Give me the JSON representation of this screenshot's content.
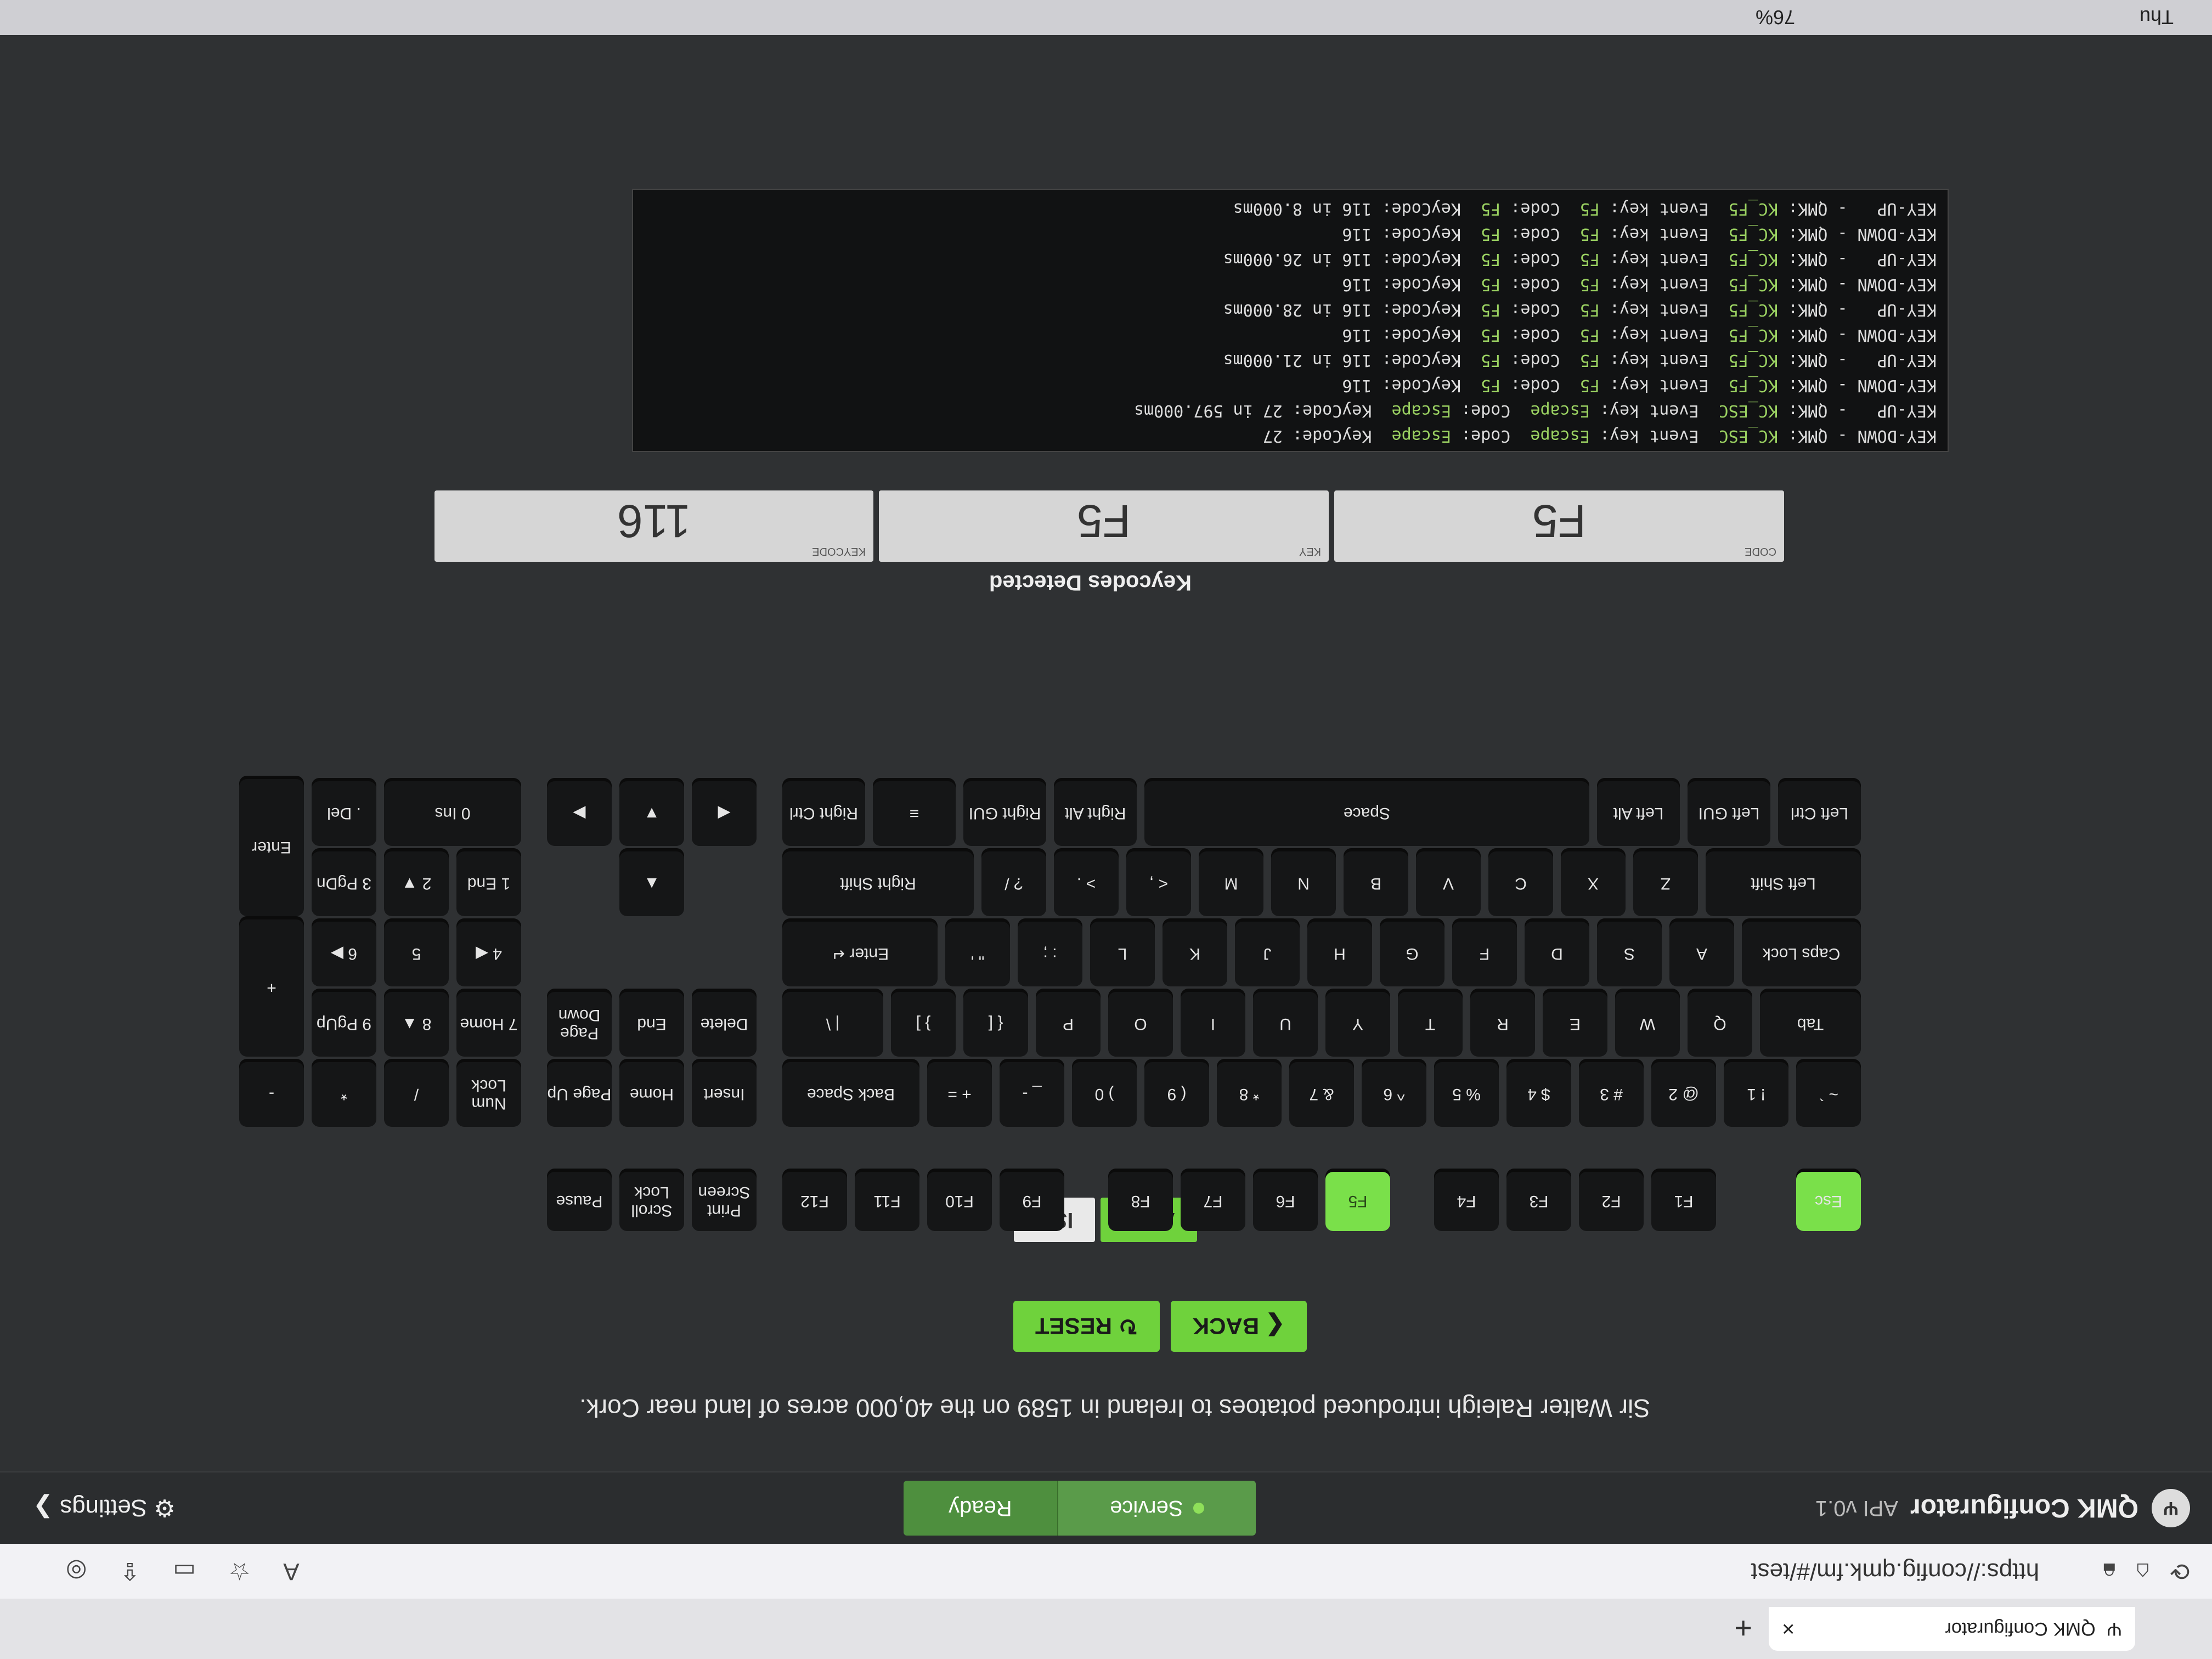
{
  "browser": {
    "tab_title": "QMK Configurator",
    "tab_close": "×",
    "new_tab": "+",
    "url": "https://config.qmk.fm/#/test",
    "os_clock": "Thu",
    "battery": "76%"
  },
  "app": {
    "logo_text": "Ψ",
    "title": "QMK Configurator",
    "api_version": "API v0.1",
    "status_service": "Service",
    "status_ready": "Ready",
    "settings": "Settings"
  },
  "tip": "Sir Walter Raleigh introduced potatoes to Ireland in 1589 on the 40,000 acres of land near Cork.",
  "buttons": {
    "back": "❮ BACK",
    "reset": "↻ RESET"
  },
  "layout_switch": {
    "ansi": "ANSI",
    "iso": "ISO"
  },
  "keys": {
    "esc": "Esc",
    "f1": "F1",
    "f2": "F2",
    "f3": "F3",
    "f4": "F4",
    "f5": "F5",
    "f6": "F6",
    "f7": "F7",
    "f8": "F8",
    "f9": "F9",
    "f10": "F10",
    "f11": "F11",
    "f12": "F12",
    "prtsc": "Print Screen",
    "scrlk": "Scroll Lock",
    "pause": "Pause",
    "grave": "~ `",
    "n1": "! 1",
    "n2": "@ 2",
    "n3": "# 3",
    "n4": "$ 4",
    "n5": "% 5",
    "n6": "^ 6",
    "n7": "& 7",
    "n8": "* 8",
    "n9": "( 9",
    "n0": ") 0",
    "minus": "_ -",
    "equal": "+ =",
    "bksp": "Back Space",
    "ins": "Insert",
    "home": "Home",
    "pgup": "Page Up",
    "numlk": "Num Lock",
    "pslash": "/",
    "pstar": "*",
    "pminus": "-",
    "tab": "Tab",
    "q": "Q",
    "w": "W",
    "e": "E",
    "r": "R",
    "t": "T",
    "y": "Y",
    "u": "U",
    "i": "I",
    "o": "O",
    "p": "P",
    "lbr": "{ [",
    "rbr": "} ]",
    "bsl": "| \\",
    "del": "Delete",
    "end": "End",
    "pgdn": "Page Down",
    "p7": "7 Home",
    "p8": "8 ▲",
    "p9": "9 PgUp",
    "pplus": "+",
    "caps": "Caps Lock",
    "a": "A",
    "s": "S",
    "d": "D",
    "f": "F",
    "g": "G",
    "h": "H",
    "j": "J",
    "k": "K",
    "l": "L",
    "semi": ": ;",
    "quot": "\" '",
    "enter": "Enter ↵",
    "p4": "4 ◀",
    "p5": "5",
    "p6": "6 ▶",
    "lshift": "Left Shift",
    "z": "Z",
    "x": "X",
    "c": "C",
    "v": "V",
    "b": "B",
    "n": "N",
    "m": "M",
    "comma": "< ,",
    "dot": "> .",
    "slash": "? /",
    "rshift": "Right Shift",
    "up": "▲",
    "p1": "1 End",
    "p2": "2 ▼",
    "p3": "3 PgDn",
    "penter": "Enter",
    "lctrl": "Left Ctrl",
    "lgui": "Left GUI",
    "lalt": "Left Alt",
    "space": "Space",
    "ralt": "Right Alt",
    "rgui": "Right GUI",
    "menu": "≡",
    "rctrl": "Right Ctrl",
    "left": "◀",
    "down": "▼",
    "right": "▶",
    "p0": "0 Ins",
    "pdot": ". Del"
  },
  "detected": {
    "heading": "Keycodes Detected",
    "code_label": "CODE",
    "code": "F5",
    "key_label": "KEY",
    "key": "F5",
    "keycode_label": "KEYCODE",
    "keycode": "116"
  },
  "log": [
    {
      "ev": "KEY-DOWN",
      "qmk": "KC_ESC",
      "key": "Escape",
      "code": "Escape",
      "kc": "27",
      "t": ""
    },
    {
      "ev": "KEY-UP  ",
      "qmk": "KC_ESC",
      "key": "Escape",
      "code": "Escape",
      "kc": "27",
      "t": " in 597.000ms"
    },
    {
      "ev": "KEY-DOWN",
      "qmk": "KC_F5",
      "key": "F5",
      "code": "F5",
      "kc": "116",
      "t": ""
    },
    {
      "ev": "KEY-UP  ",
      "qmk": "KC_F5",
      "key": "F5",
      "code": "F5",
      "kc": "116",
      "t": " in 21.000ms"
    },
    {
      "ev": "KEY-DOWN",
      "qmk": "KC_F5",
      "key": "F5",
      "code": "F5",
      "kc": "116",
      "t": ""
    },
    {
      "ev": "KEY-UP  ",
      "qmk": "KC_F5",
      "key": "F5",
      "code": "F5",
      "kc": "116",
      "t": " in 28.000ms"
    },
    {
      "ev": "KEY-DOWN",
      "qmk": "KC_F5",
      "key": "F5",
      "code": "F5",
      "kc": "116",
      "t": ""
    },
    {
      "ev": "KEY-UP  ",
      "qmk": "KC_F5",
      "key": "F5",
      "code": "F5",
      "kc": "116",
      "t": " in 26.000ms"
    },
    {
      "ev": "KEY-DOWN",
      "qmk": "KC_F5",
      "key": "F5",
      "code": "F5",
      "kc": "116",
      "t": ""
    },
    {
      "ev": "KEY-UP  ",
      "qmk": "KC_F5",
      "key": "F5",
      "code": "F5",
      "kc": "116",
      "t": " in 8.000ms"
    }
  ],
  "colors": {
    "accent": "#6fd23c",
    "pressed": "#7ae04a",
    "key_bg": "#151617",
    "page_bg": "#2f3133"
  }
}
